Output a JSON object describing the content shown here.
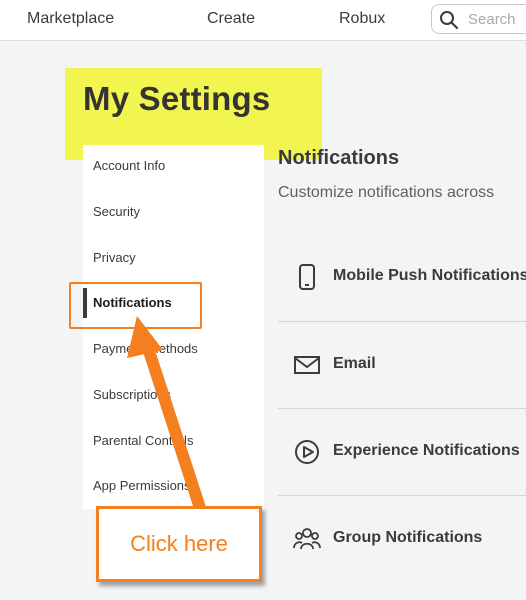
{
  "topnav": {
    "items": [
      "Marketplace",
      "Create",
      "Robux"
    ],
    "search": {
      "placeholder": "Search",
      "icon": "search-icon"
    }
  },
  "page": {
    "title": "My Settings"
  },
  "sidebar": {
    "items": [
      {
        "label": "Account Info"
      },
      {
        "label": "Security"
      },
      {
        "label": "Privacy"
      },
      {
        "label": "Notifications",
        "active": true
      },
      {
        "label": "Payment Methods"
      },
      {
        "label": "Subscriptions"
      },
      {
        "label": "Parental Controls"
      },
      {
        "label": "App Permissions"
      }
    ]
  },
  "main": {
    "title": "Notifications",
    "subtitle": "Customize notifications across",
    "rows": [
      {
        "label": "Mobile Push Notifications",
        "icon": "phone-icon"
      },
      {
        "label": "Email",
        "icon": "mail-icon"
      },
      {
        "label": "Experience Notifications",
        "icon": "play-icon"
      },
      {
        "label": "Group Notifications",
        "icon": "group-icon"
      }
    ]
  },
  "annotation": {
    "text": "Click here",
    "color": "#f47f1f"
  },
  "colors": {
    "highlight": "#f2f54f",
    "accent": "#f47f1f",
    "page_bg": "#f2f4f5"
  }
}
